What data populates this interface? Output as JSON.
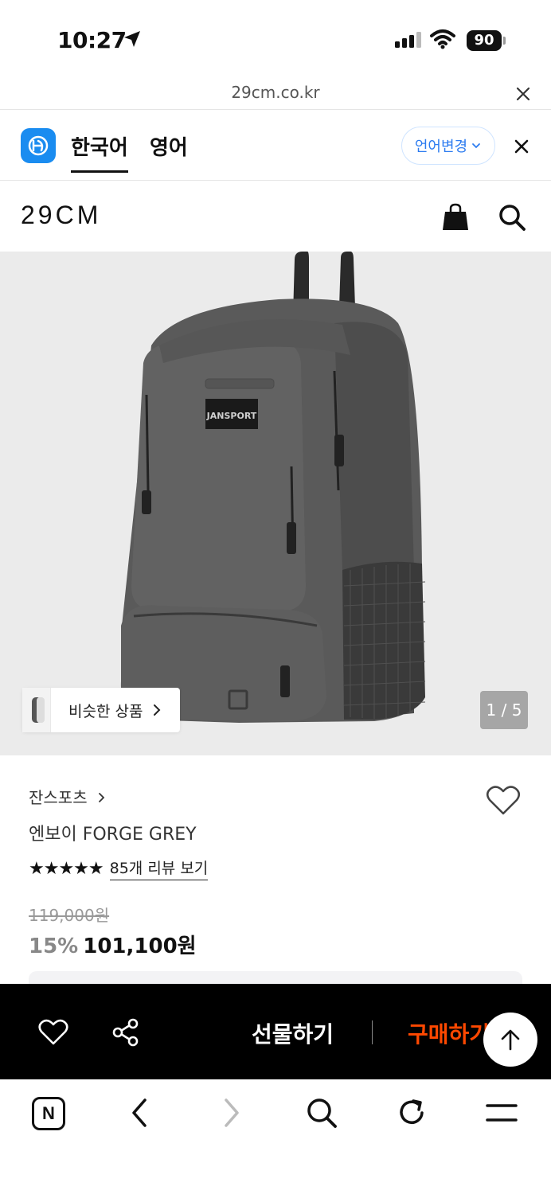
{
  "status_bar": {
    "time": "10:27",
    "battery": "90"
  },
  "browser": {
    "url": "29cm.co.kr"
  },
  "translate_bar": {
    "tab_korean": "한국어",
    "tab_english": "영어",
    "language_change": "언어변경"
  },
  "site_header": {
    "brand": "29CM"
  },
  "gallery": {
    "similar_products_label": "비슷한 상품",
    "pager": "1 / 5"
  },
  "product": {
    "brand": "잔스포츠",
    "name": "엔보이 FORGE GREY",
    "rating_stars": "★★★★★",
    "review_link": "85개 리뷰 보기",
    "original_price": "119,000원",
    "discount": "15%",
    "price": "101,100원"
  },
  "action_bar": {
    "gift_label": "선물하기",
    "buy_label": "구매하기"
  },
  "icons": {
    "accent": "#ff4800",
    "translate_accent": "#1a8cf0"
  }
}
